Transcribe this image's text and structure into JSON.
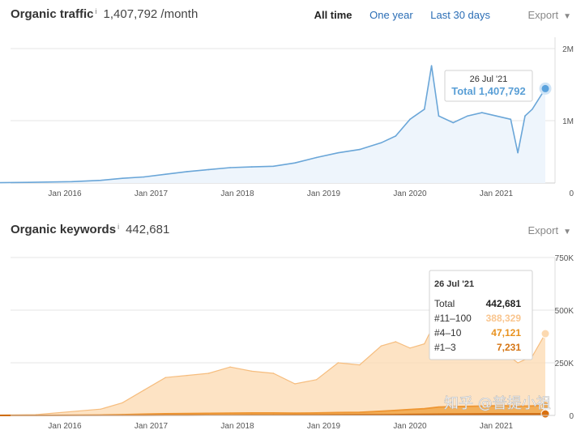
{
  "traffic": {
    "title": "Organic traffic",
    "info": "i",
    "value": "1,407,792 /month",
    "ranges": [
      "All time",
      "One year",
      "Last 30 days"
    ],
    "export_label": "Export"
  },
  "keywords": {
    "title": "Organic keywords",
    "info": "i",
    "value": "442,681",
    "export_label": "Export"
  },
  "watermark": "知乎 @普提小祖",
  "colors": {
    "traffic_line": "#6aa6d8",
    "traffic_fill": "#eef5fc",
    "kw_11_100": "#fcd9b0",
    "kw_4_10": "#f2a94e",
    "kw_1_3": "#d9700f",
    "link": "#2a6db5"
  },
  "chart_data": [
    {
      "type": "area",
      "title": "Organic traffic",
      "x_ticks": [
        "Jan 2016",
        "Jan 2017",
        "Jan 2018",
        "Jan 2019",
        "Jan 2020",
        "Jan 2021"
      ],
      "y_ticks": [
        "2M",
        "1M",
        "0"
      ],
      "ylim": [
        0,
        2000000
      ],
      "grid": true,
      "series": [
        {
          "x": [
            "2015-03",
            "2015-08",
            "2016-02",
            "2016-06",
            "2016-09",
            "2016-12",
            "2017-03",
            "2017-06",
            "2017-09",
            "2017-12",
            "2018-03",
            "2018-06",
            "2018-09",
            "2018-12",
            "2019-03",
            "2019-06",
            "2019-09",
            "2019-11",
            "2020-01",
            "2020-03",
            "2020-04",
            "2020-05",
            "2020-07",
            "2020-09",
            "2020-11",
            "2021-01",
            "2021-03",
            "2021-04",
            "2021-05",
            "2021-06",
            "2021-07-26"
          ],
          "values": [
            5000,
            10000,
            20000,
            40000,
            70000,
            90000,
            130000,
            170000,
            200000,
            230000,
            240000,
            250000,
            300000,
            380000,
            450000,
            500000,
            600000,
            700000,
            950000,
            1100000,
            1750000,
            1000000,
            900000,
            1000000,
            1050000,
            1000000,
            950000,
            450000,
            1000000,
            1100000,
            1407792
          ]
        }
      ],
      "tooltip": {
        "date": "26 Jul '21",
        "label": "Total",
        "value": "1,407,792"
      }
    },
    {
      "type": "area",
      "title": "Organic keywords",
      "x_ticks": [
        "Jan 2016",
        "Jan 2017",
        "Jan 2018",
        "Jan 2019",
        "Jan 2020",
        "Jan 2021"
      ],
      "y_ticks": [
        "750K",
        "500K",
        "250K",
        "0"
      ],
      "ylim": [
        0,
        750000
      ],
      "grid": true,
      "x": [
        "2015-03",
        "2015-09",
        "2016-06",
        "2016-09",
        "2016-12",
        "2017-03",
        "2017-06",
        "2017-09",
        "2017-12",
        "2018-03",
        "2018-06",
        "2018-09",
        "2018-12",
        "2019-03",
        "2019-06",
        "2019-09",
        "2019-11",
        "2020-01",
        "2020-03",
        "2020-05",
        "2020-07",
        "2020-10",
        "2020-12",
        "2021-02",
        "2021-04",
        "2021-06",
        "2021-07-26"
      ],
      "series": [
        {
          "name": "#11–100",
          "values": [
            2000,
            4000,
            30000,
            60000,
            120000,
            180000,
            190000,
            200000,
            230000,
            210000,
            200000,
            150000,
            170000,
            250000,
            240000,
            330000,
            350000,
            320000,
            340000,
            480000,
            460000,
            380000,
            330000,
            300000,
            250000,
            280000,
            388329
          ]
        },
        {
          "name": "#4–10",
          "values": [
            0,
            500,
            2000,
            4000,
            6000,
            8000,
            9000,
            10000,
            11000,
            12000,
            12000,
            11000,
            12000,
            14000,
            15000,
            20000,
            24000,
            28000,
            32000,
            40000,
            42000,
            44000,
            45000,
            46000,
            44000,
            45000,
            47121
          ]
        },
        {
          "name": "#1–3",
          "values": [
            0,
            100,
            300,
            500,
            800,
            1000,
            1200,
            1400,
            1600,
            1800,
            2000,
            2200,
            2400,
            2800,
            3000,
            3600,
            4000,
            4500,
            5000,
            5800,
            6000,
            6400,
            6800,
            7000,
            7000,
            7100,
            7231
          ]
        }
      ],
      "tooltip": {
        "date": "26 Jul '21",
        "rows": [
          {
            "label": "Total",
            "value": "442,681"
          },
          {
            "label": "#11–100",
            "value": "388,329"
          },
          {
            "label": "#4–10",
            "value": "47,121"
          },
          {
            "label": "#1–3",
            "value": "7,231"
          }
        ]
      }
    }
  ]
}
